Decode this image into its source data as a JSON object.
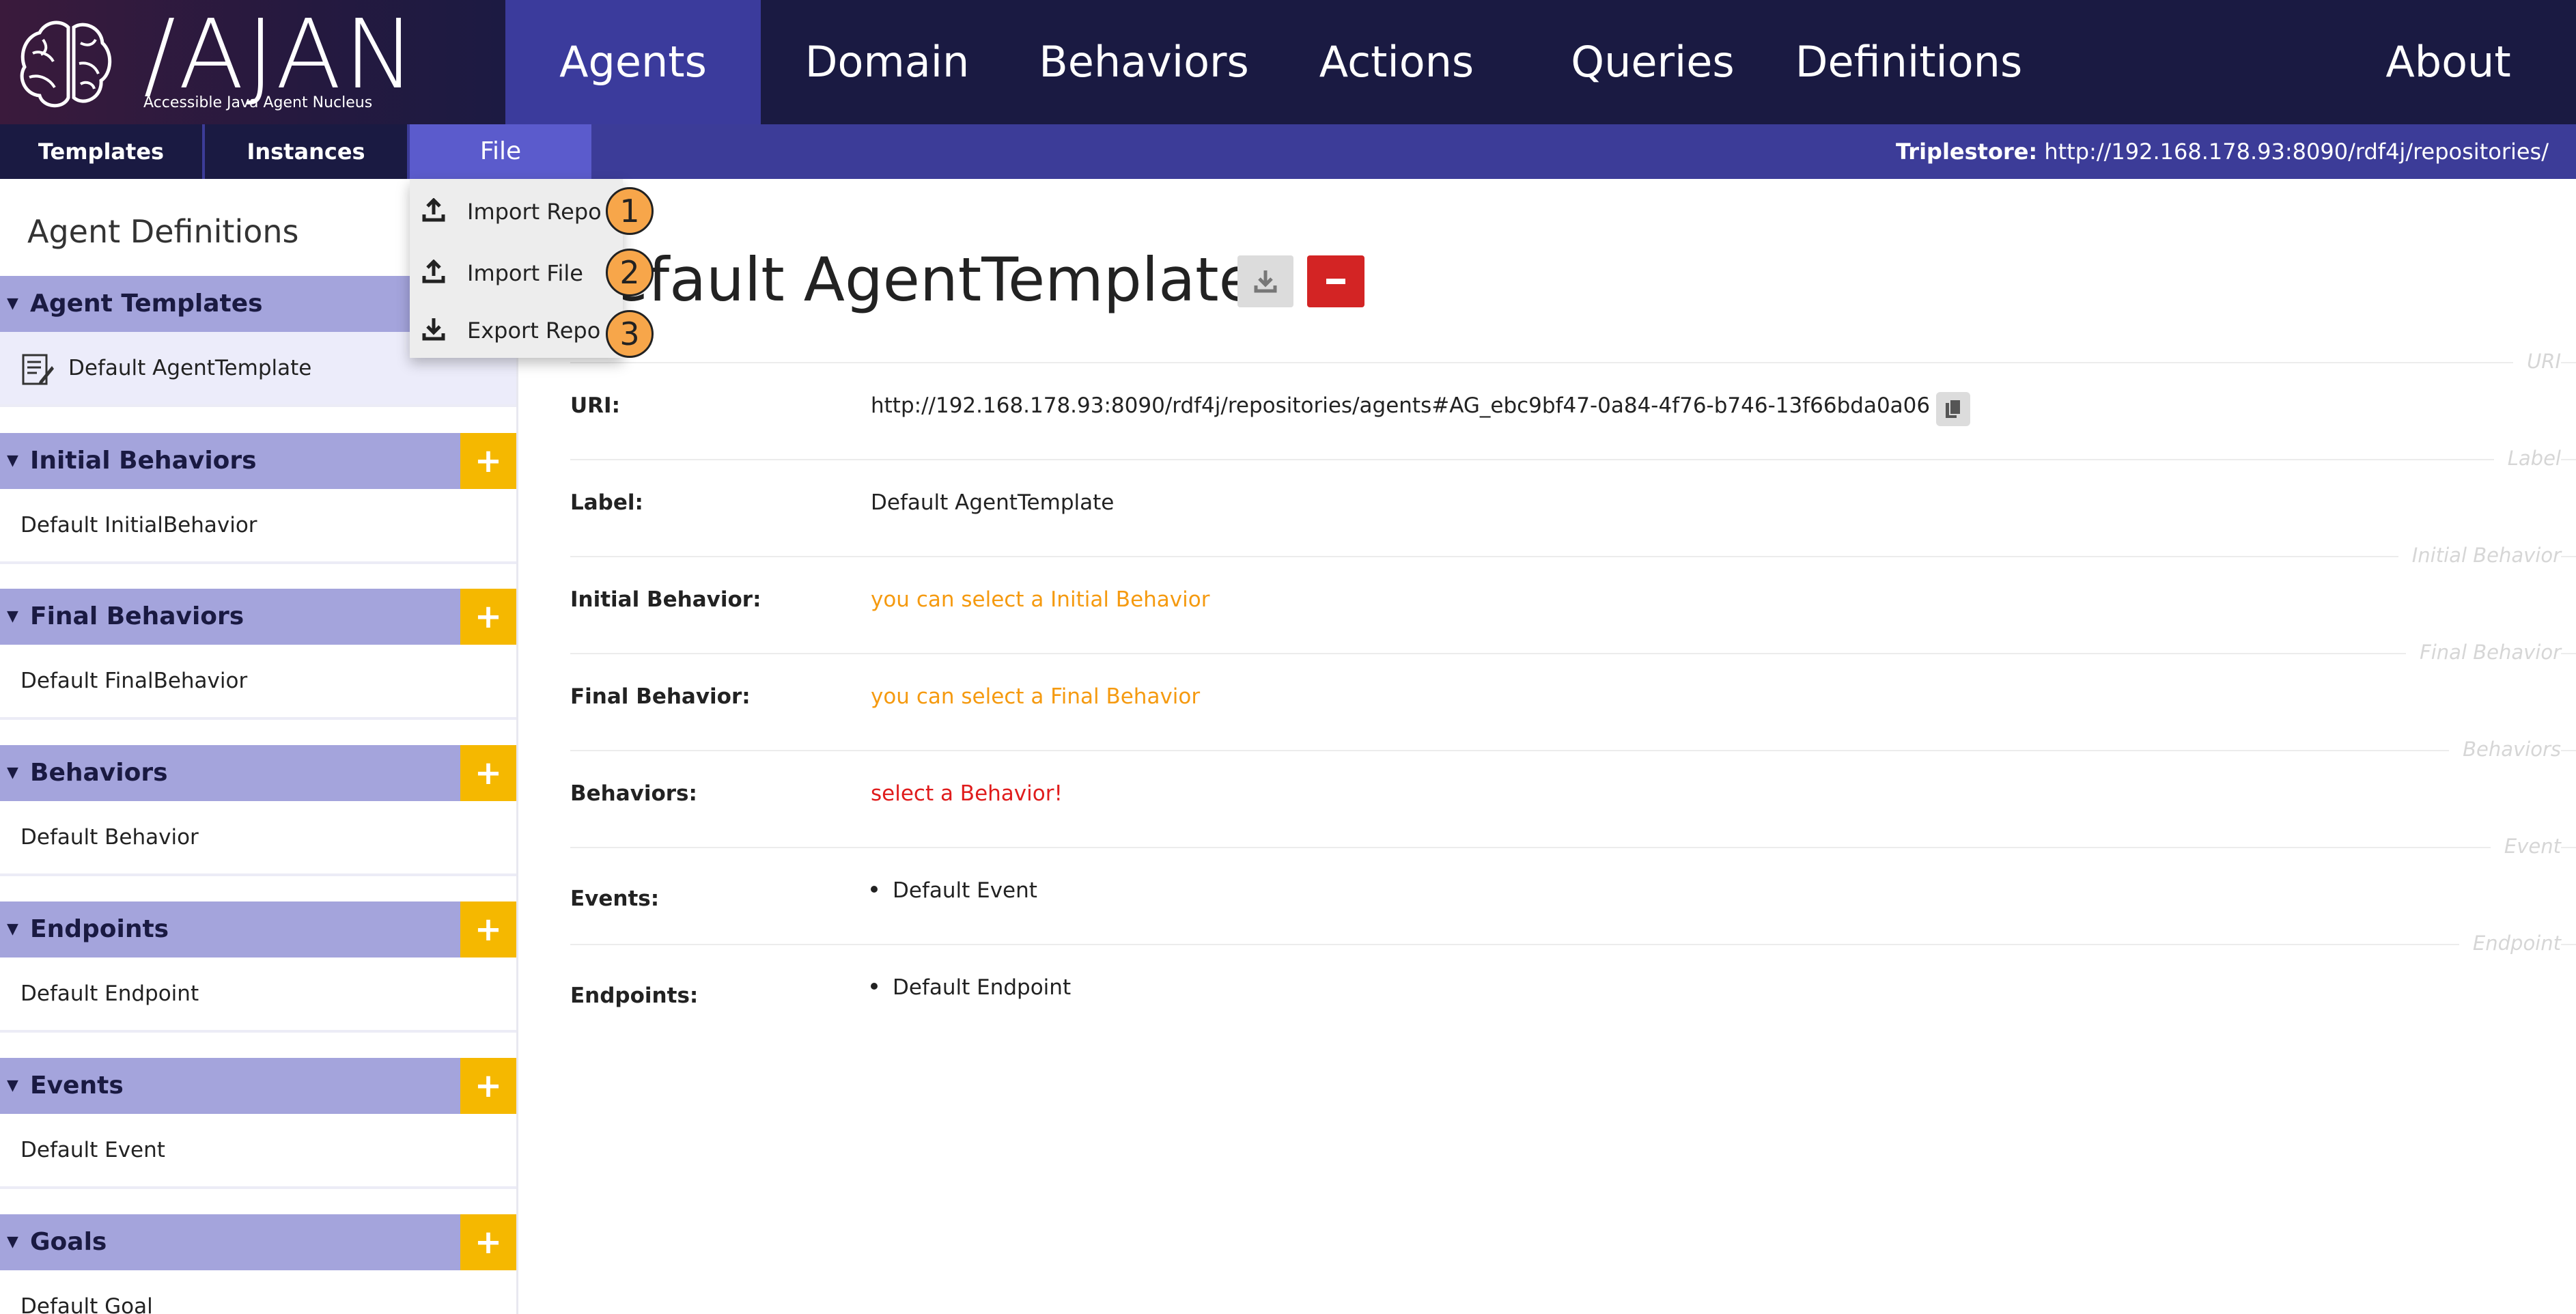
{
  "logo": {
    "title": "/AJAN",
    "subtitle": "Accessible Java Agent Nucleus"
  },
  "nav": {
    "items": [
      {
        "label": "Agents"
      },
      {
        "label": "Domain"
      },
      {
        "label": "Behaviors"
      },
      {
        "label": "Actions"
      },
      {
        "label": "Queries"
      },
      {
        "label": "Definitions"
      },
      {
        "label": "About"
      }
    ],
    "active": "Agents"
  },
  "subnav": {
    "tabs": [
      {
        "label": "Templates"
      },
      {
        "label": "Instances"
      },
      {
        "label": "File"
      }
    ],
    "triplestore_label": "Triplestore:",
    "triplestore_url": "http://192.168.178.93:8090/rdf4j/repositories/"
  },
  "file_menu": {
    "items": [
      {
        "label": "Import Repo",
        "icon": "upload-icon",
        "callout": "1"
      },
      {
        "label": "Import File",
        "icon": "upload-icon",
        "callout": "2"
      },
      {
        "label": "Export Repo",
        "icon": "download-icon",
        "callout": "3"
      }
    ]
  },
  "sidebar": {
    "title": "Agent Definitions",
    "sections": [
      {
        "label": "Agent Templates",
        "items": [
          "Default AgentTemplate"
        ],
        "addable": false
      },
      {
        "label": "Initial Behaviors",
        "items": [
          "Default InitialBehavior"
        ],
        "addable": true
      },
      {
        "label": "Final Behaviors",
        "items": [
          "Default FinalBehavior"
        ],
        "addable": true
      },
      {
        "label": "Behaviors",
        "items": [
          "Default Behavior"
        ],
        "addable": true
      },
      {
        "label": "Endpoints",
        "items": [
          "Default Endpoint"
        ],
        "addable": true
      },
      {
        "label": "Events",
        "items": [
          "Default Event"
        ],
        "addable": true
      },
      {
        "label": "Goals",
        "items": [
          "Default Goal"
        ],
        "addable": true
      }
    ]
  },
  "main": {
    "title": "Default AgentTemplate",
    "visible_title": "efault AgentTemplate",
    "rows": [
      {
        "ghost": "URI",
        "label": "URI:",
        "value": "http://192.168.178.93:8090/rdf4j/repositories/agents#AG_ebc9bf47-0a84-4f76-b746-13f66bda0a06"
      },
      {
        "ghost": "Label",
        "label": "Label:",
        "value": "Default AgentTemplate"
      },
      {
        "ghost": "Initial Behavior",
        "label": "Initial Behavior:",
        "value": "you can select a Initial Behavior"
      },
      {
        "ghost": "Final Behavior",
        "label": "Final Behavior:",
        "value": "you can select a Final Behavior"
      },
      {
        "ghost": "Behaviors",
        "label": "Behaviors:",
        "value": "select a Behavior!"
      },
      {
        "ghost": "Event",
        "label": "Events:",
        "value": "Default Event"
      },
      {
        "ghost": "Endpoint",
        "label": "Endpoints:",
        "value": "Default Endpoint"
      }
    ]
  },
  "colors": {
    "nav_bg": "#1a1a42",
    "nav_active": "#3b3b9c",
    "subnav_bg": "#3c3c98",
    "section_header": "#a4a4dc",
    "add_button": "#f5b800",
    "delete_button": "#d32424",
    "hint_orange": "#f59a10",
    "error_red": "#e01c1c"
  }
}
